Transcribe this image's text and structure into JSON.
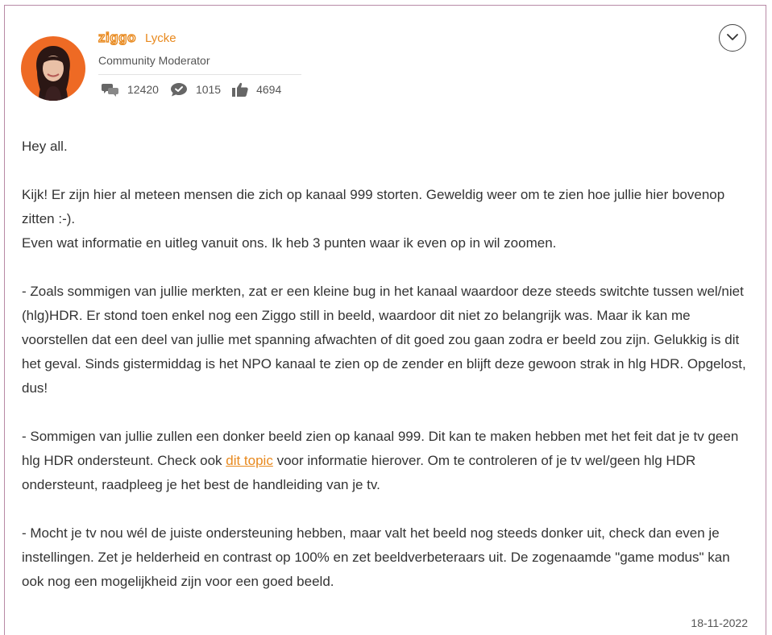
{
  "author": {
    "brand": "ziggo",
    "name": "Lycke",
    "role": "Community Moderator",
    "avatar_bg": "#ee6a24",
    "brand_color": "#e8891e"
  },
  "stats": [
    {
      "icon": "conversations-icon",
      "value": "12420"
    },
    {
      "icon": "reply-bubble-icon",
      "value": "1015"
    },
    {
      "icon": "thumbs-up-icon",
      "value": "4694"
    }
  ],
  "post": {
    "greeting": "Hey all.",
    "p1_line1": "Kijk! Er zijn hier al meteen mensen die zich op kanaal 999 storten. Geweldig weer om te zien hoe jullie hier bovenop zitten :-).",
    "p1_line2": "Even wat informatie en uitleg vanuit ons. Ik heb 3 punten waar ik even op in wil zoomen.",
    "p2": "- Zoals sommigen van jullie merkten, zat er een kleine bug in het kanaal waardoor deze steeds switchte tussen wel/niet (hlg)HDR. Er stond toen enkel nog een Ziggo still in beeld, waardoor dit niet zo belangrijk was. Maar ik kan me voorstellen dat een deel van jullie met spanning afwachten of dit goed zou gaan zodra er beeld zou zijn. Gelukkig is dit het geval. Sinds gistermiddag is het NPO kanaal te zien op de zender en blijft deze gewoon strak in hlg HDR. Opgelost, dus!",
    "p3_before": "- Sommigen van jullie zullen een donker beeld zien op kanaal 999. Dit kan te maken hebben met het feit dat je tv geen hlg HDR ondersteunt. Check ook ",
    "p3_link": "dit topic",
    "p3_after": " voor informatie hierover. Om te controleren of je tv wel/geen hlg HDR ondersteunt, raadpleeg je het best de handleiding van je tv.",
    "p4": "- Mocht je tv nou wél de juiste ondersteuning hebben, maar valt het beeld nog steeds donker uit, check dan even je instellingen. Zet je helderheid en contrast op 100% en zet beeldverbeteraars uit. De zogenaamde \"game modus\" kan ook nog een mogelijkheid zijn voor een goed beeld.",
    "date": "18-11-2022"
  }
}
